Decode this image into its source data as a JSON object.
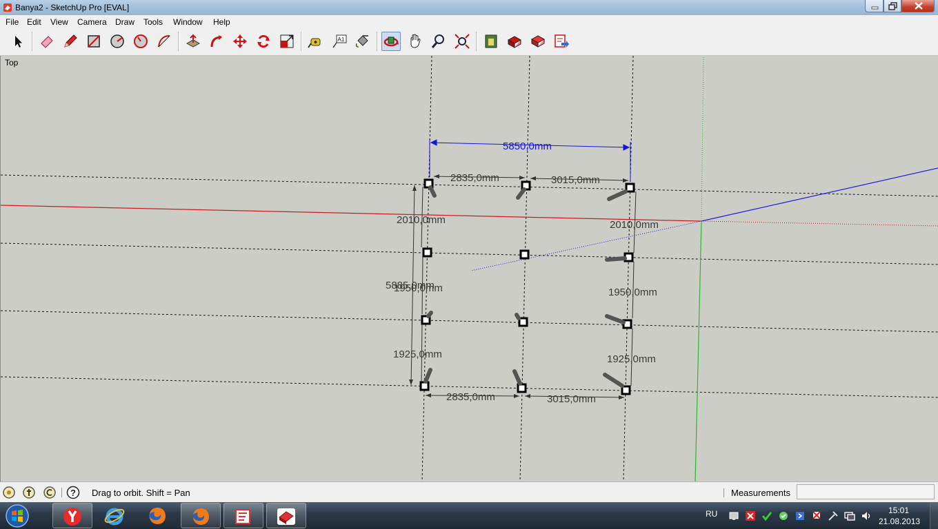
{
  "window": {
    "title": "Banya2 - SketchUp Pro [EVAL]"
  },
  "menu": [
    "File",
    "Edit",
    "View",
    "Camera",
    "Draw",
    "Tools",
    "Window",
    "Help"
  ],
  "toolbar": {
    "tools": [
      "select",
      "eraser",
      "pencil",
      "rectangle",
      "circle",
      "polygon",
      "arc",
      "push-pull",
      "follow-me",
      "move",
      "rotate",
      "scale",
      "tape-measure",
      "text",
      "paint-bucket",
      "orbit",
      "pan",
      "zoom",
      "zoom-extents",
      "get-models",
      "share-model",
      "share-component",
      "send-to-layout"
    ],
    "active_tool": "orbit"
  },
  "viewport": {
    "view_name": "Top",
    "dimensions": {
      "total_width": "5850,0mm",
      "top_left_span": "2835,0mm",
      "top_right_span": "3015,0mm",
      "bottom_left_span": "2835,0mm",
      "bottom_right_span": "3015,0mm",
      "left_seg1": "2010,0mm",
      "left_seg2": "1950,0mm",
      "left_seg3": "1925,0mm",
      "left_total": "5885,0mm",
      "right_seg1": "2010,0mm",
      "right_seg2": "1950,0mm",
      "right_seg3": "1925,0mm"
    },
    "axis_colors": {
      "red": "#cc1e1e",
      "green": "#2db52d",
      "blue": "#1e1ee0"
    }
  },
  "statusbar": {
    "hint": "Drag to orbit.  Shift = Pan",
    "measurements_label": "Measurements",
    "measurements_value": ""
  },
  "taskbar": {
    "apps": [
      "yandex-browser",
      "internet-explorer",
      "firefox",
      "firefox",
      "layout",
      "sketchup"
    ],
    "language": "RU",
    "time": "15:01",
    "date": "21.08.2013"
  }
}
